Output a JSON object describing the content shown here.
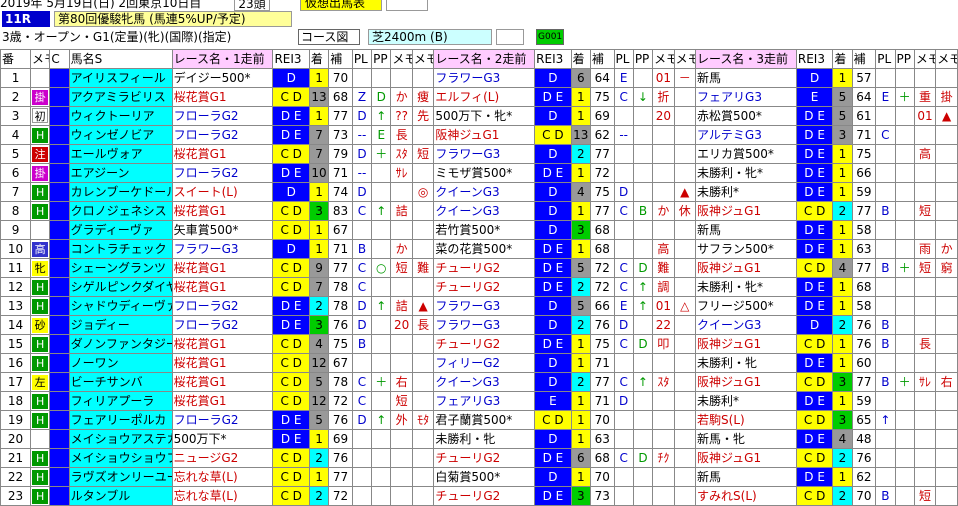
{
  "header": {
    "date": "2019年 5月19日(日) 2回東京10日目",
    "count": "23頭",
    "mode": "仮想出馬表",
    "race_no": "11R",
    "race_title": "第80回優駿牝馬 (馬連5%UP/予定)",
    "conditions": "3歳・オープン・G1(定量)(牝)(国際)(指定)",
    "course_label": "コース図",
    "course": "芝2400m (B)",
    "tag": "G001"
  },
  "columns": [
    "番",
    "メモ",
    "C",
    "馬名S",
    "レース名・1走前",
    "REI3",
    "着",
    "補",
    "PL",
    "PP",
    "メモ",
    "メモ",
    "レース名・2走前",
    "REI3",
    "着",
    "補",
    "PL",
    "PP",
    "メモ",
    "メモ",
    "レース名・3走前",
    "REI3",
    "着",
    "補",
    "PL",
    "PP",
    "メモ",
    "メモ"
  ],
  "rows": [
    {
      "no": "1",
      "memo": "",
      "c": "",
      "cc": "",
      "name": "アイリスフィール",
      "r1": "デイジー500*",
      "r1c": "black",
      "g1": "D",
      "g1b": "bgB",
      "p1": "1",
      "p1b": "bgY",
      "h1": "70",
      "pl1": "",
      "pp1": "",
      "m1a": "",
      "m1b": "",
      "r2": "フラワーG3",
      "r2c": "blue",
      "g2": "D",
      "g2b": "bgB",
      "p2": "6",
      "p2b": "bgGray",
      "h2": "64",
      "pl2": "E",
      "pp2": "",
      "m2a": "01",
      "m2b": "－",
      "r3": "新馬",
      "r3c": "black",
      "g3": "D",
      "g3b": "bgB",
      "p3": "1",
      "p3b": "bgY",
      "h3": "57",
      "pl3": "",
      "pp3": "",
      "m3a": "",
      "m3b": ""
    },
    {
      "no": "2",
      "memo": "掛",
      "mc": "t-purple",
      "c": "",
      "cc": "",
      "name": "アクアミラビリス",
      "r1": "桜花賞G1",
      "r1c": "",
      "g1": "C D",
      "g1b": "bgY",
      "p1": "13",
      "p1b": "bgGray",
      "h1": "68",
      "pl1": "Z",
      "pp1": "D",
      "m1a": "か",
      "m1b": "痩",
      "r2": "エルフィ(L)",
      "r2c": "",
      "g2": "D E",
      "g2b": "bgB",
      "p2": "1",
      "p2b": "bgY",
      "h2": "75",
      "pl2": "C",
      "pp2": "↓",
      "m2a": "折",
      "m2b": "",
      "r3": "フェアリG3",
      "r3c": "blue",
      "g3": "E",
      "g3b": "bgB",
      "p3": "5",
      "p3b": "bgGray",
      "h3": "64",
      "pl3": "E",
      "pp3": "＋",
      "m3a": "重",
      "m3b": "掛"
    },
    {
      "no": "3",
      "memo": "初",
      "mc": "t-white",
      "c": "",
      "cc": "",
      "name": "ウィクトーリア",
      "r1": "フローラG2",
      "r1c": "blue",
      "g1": "D E",
      "g1b": "bgB",
      "p1": "1",
      "p1b": "bgY",
      "h1": "77",
      "pl1": "D",
      "pp1": "↑",
      "m1a": "??",
      "m1b": "先",
      "r2": "500万下・牝*",
      "r2c": "black",
      "g2": "D",
      "g2b": "bgB",
      "p2": "1",
      "p2b": "bgY",
      "h2": "69",
      "pl2": "",
      "pp2": "",
      "m2a": "20",
      "m2b": "",
      "r3": "赤松賞500*",
      "r3c": "black",
      "g3": "D E",
      "g3b": "bgB",
      "p3": "5",
      "p3b": "bgGray",
      "h3": "61",
      "pl3": "",
      "pp3": "",
      "m3a": "01",
      "m3b": "▲"
    },
    {
      "no": "4",
      "memo": "H",
      "mc": "t-green",
      "c": "",
      "cc": "",
      "name": "ウィンゼノビア",
      "r1": "フローラG2",
      "r1c": "blue",
      "g1": "D E",
      "g1b": "bgB",
      "p1": "7",
      "p1b": "bgGray",
      "h1": "73",
      "pl1": "--",
      "pp1": "E",
      "m1a": "長",
      "m1b": "",
      "r2": "阪神ジュG1",
      "r2c": "",
      "g2": "C D",
      "g2b": "bgY",
      "p2": "13",
      "p2b": "bgGray",
      "h2": "62",
      "pl2": "--",
      "pp2": "",
      "m2a": "",
      "m2b": "",
      "r3": "アルテミG3",
      "r3c": "blue",
      "g3": "D E",
      "g3b": "bgB",
      "p3": "3",
      "p3b": "bgGray",
      "h3": "71",
      "pl3": "C",
      "pp3": "",
      "m3a": "",
      "m3b": ""
    },
    {
      "no": "5",
      "memo": "注",
      "mc": "t-red",
      "c": "",
      "cc": "",
      "name": "エールヴォア",
      "r1": "桜花賞G1",
      "r1c": "",
      "g1": "C D",
      "g1b": "bgY",
      "p1": "7",
      "p1b": "bgGray",
      "h1": "79",
      "pl1": "D",
      "pp1": "＋",
      "m1a": "ｽﾀ",
      "m1b": "短",
      "r2": "フラワーG3",
      "r2c": "blue",
      "g2": "D",
      "g2b": "bgB",
      "p2": "2",
      "p2b": "bgC",
      "h2": "77",
      "pl2": "",
      "pp2": "",
      "m2a": "",
      "m2b": "",
      "r3": "エリカ賞500*",
      "r3c": "black",
      "g3": "D E",
      "g3b": "bgB",
      "p3": "1",
      "p3b": "bgY",
      "h3": "75",
      "pl3": "",
      "pp3": "",
      "m3a": "高",
      "m3b": ""
    },
    {
      "no": "6",
      "memo": "掛",
      "mc": "t-purple",
      "c": "",
      "cc": "",
      "name": "エアジーン",
      "r1": "フローラG2",
      "r1c": "blue",
      "g1": "D E",
      "g1b": "bgB",
      "p1": "10",
      "p1b": "bgGray",
      "h1": "71",
      "pl1": "--",
      "pp1": "",
      "m1a": "ｻﾚ",
      "m1b": "",
      "r2": "ミモザ賞500*",
      "r2c": "black",
      "g2": "D E",
      "g2b": "bgB",
      "p2": "1",
      "p2b": "bgY",
      "h2": "72",
      "pl2": "",
      "pp2": "",
      "m2a": "",
      "m2b": "",
      "r3": "未勝利・牝*",
      "r3c": "black",
      "g3": "D E",
      "g3b": "bgB",
      "p3": "1",
      "p3b": "bgY",
      "h3": "66",
      "pl3": "",
      "pp3": "",
      "m3a": "",
      "m3b": ""
    },
    {
      "no": "7",
      "memo": "H",
      "mc": "t-green",
      "c": "",
      "cc": "",
      "name": "カレンブーケドール",
      "r1": "スイート(L)",
      "r1c": "",
      "g1": "D",
      "g1b": "bgB",
      "p1": "1",
      "p1b": "bgY",
      "h1": "74",
      "pl1": "D",
      "pp1": "",
      "m1a": "",
      "m1b": "◎",
      "r2": "クイーンG3",
      "r2c": "blue",
      "g2": "D",
      "g2b": "bgB",
      "p2": "4",
      "p2b": "bgGray",
      "h2": "75",
      "pl2": "D",
      "pp2": "",
      "m2a": "",
      "m2b": "▲",
      "r3": "未勝利*",
      "r3c": "black",
      "g3": "D E",
      "g3b": "bgB",
      "p3": "1",
      "p3b": "bgY",
      "h3": "59",
      "pl3": "",
      "pp3": "",
      "m3a": "",
      "m3b": ""
    },
    {
      "no": "8",
      "memo": "H",
      "mc": "t-green",
      "c": "",
      "cc": "",
      "name": "クロノジェネシス",
      "r1": "桜花賞G1",
      "r1c": "",
      "g1": "C D",
      "g1b": "bgY",
      "p1": "3",
      "p1b": "bgG",
      "h1": "83",
      "pl1": "C",
      "pp1": "↑",
      "m1a": "詰",
      "m1b": "",
      "r2": "クイーンG3",
      "r2c": "blue",
      "g2": "D",
      "g2b": "bgB",
      "p2": "1",
      "p2b": "bgY",
      "h2": "77",
      "pl2": "C",
      "pp2": "B",
      "m2a": "か",
      "m2b": "休",
      "r3": "阪神ジュG1",
      "r3c": "",
      "g3": "C D",
      "g3b": "bgY",
      "p3": "2",
      "p3b": "bgC",
      "h3": "77",
      "pl3": "B",
      "pp3": "",
      "m3a": "短",
      "m3b": ""
    },
    {
      "no": "9",
      "memo": "",
      "c": "",
      "cc": "",
      "name": "グラディーヴァ",
      "r1": "矢車賞500*",
      "r1c": "black",
      "g1": "C D",
      "g1b": "bgY",
      "p1": "1",
      "p1b": "bgY",
      "h1": "67",
      "pl1": "",
      "pp1": "",
      "m1a": "",
      "m1b": "",
      "r2": "若竹賞500*",
      "r2c": "black",
      "g2": "D",
      "g2b": "bgB",
      "p2": "3",
      "p2b": "bgG",
      "h2": "68",
      "pl2": "",
      "pp2": "",
      "m2a": "",
      "m2b": "",
      "r3": "新馬",
      "r3c": "black",
      "g3": "D E",
      "g3b": "bgB",
      "p3": "1",
      "p3b": "bgY",
      "h3": "58",
      "pl3": "",
      "pp3": "",
      "m3a": "",
      "m3b": ""
    },
    {
      "no": "10",
      "memo": "高",
      "mc": "t-blue",
      "c": "",
      "cc": "",
      "name": "コントラチェック",
      "r1": "フラワーG3",
      "r1c": "blue",
      "g1": "D",
      "g1b": "bgB",
      "p1": "1",
      "p1b": "bgY",
      "h1": "71",
      "pl1": "B",
      "pp1": "",
      "m1a": "か",
      "m1b": "",
      "r2": "菜の花賞500*",
      "r2c": "black",
      "g2": "D E",
      "g2b": "bgB",
      "p2": "1",
      "p2b": "bgY",
      "h2": "68",
      "pl2": "",
      "pp2": "",
      "m2a": "高",
      "m2b": "",
      "r3": "サフラン500*",
      "r3c": "black",
      "g3": "D E",
      "g3b": "bgB",
      "p3": "1",
      "p3b": "bgY",
      "h3": "63",
      "pl3": "",
      "pp3": "",
      "m3a": "雨",
      "m3b": "か"
    },
    {
      "no": "11",
      "memo": "牝",
      "mc": "t-yellow",
      "c": "",
      "cc": "",
      "name": "シェーングランツ",
      "r1": "桜花賞G1",
      "r1c": "",
      "g1": "C D",
      "g1b": "bgY",
      "p1": "9",
      "p1b": "bgGray",
      "h1": "77",
      "pl1": "C",
      "pp1": "○",
      "m1a": "短",
      "m1b": "難",
      "r2": "チューリG2",
      "r2c": "",
      "g2": "D E",
      "g2b": "bgB",
      "p2": "5",
      "p2b": "bgGray",
      "h2": "72",
      "pl2": "C",
      "pp2": "D",
      "m2a": "難",
      "m2b": "",
      "r3": "阪神ジュG1",
      "r3c": "",
      "g3": "C D",
      "g3b": "bgY",
      "p3": "4",
      "p3b": "bgGray",
      "h3": "77",
      "pl3": "B",
      "pp3": "＋",
      "m3a": "短",
      "m3b": "窮"
    },
    {
      "no": "12",
      "memo": "H",
      "mc": "t-green",
      "c": "",
      "cc": "",
      "name": "シゲルピンクダイヤ",
      "r1": "桜花賞G1",
      "r1c": "",
      "g1": "C D",
      "g1b": "bgY",
      "p1": "7",
      "p1b": "bgGray",
      "h1": "78",
      "pl1": "C",
      "pp1": "",
      "m1a": "",
      "m1b": "",
      "r2": "チューリG2",
      "r2c": "",
      "g2": "D E",
      "g2b": "bgB",
      "p2": "2",
      "p2b": "bgC",
      "h2": "72",
      "pl2": "C",
      "pp2": "↑",
      "m2a": "調",
      "m2b": "",
      "r3": "未勝利・牝*",
      "r3c": "black",
      "g3": "D E",
      "g3b": "bgB",
      "p3": "1",
      "p3b": "bgY",
      "h3": "68",
      "pl3": "",
      "pp3": "",
      "m3a": "",
      "m3b": ""
    },
    {
      "no": "13",
      "memo": "H",
      "mc": "t-green",
      "c": "",
      "cc": "",
      "name": "シャドウディーヴァ",
      "r1": "フローラG2",
      "r1c": "blue",
      "g1": "D E",
      "g1b": "bgB",
      "p1": "2",
      "p1b": "bgC",
      "h1": "78",
      "pl1": "D",
      "pp1": "↑",
      "m1a": "詰",
      "m1b": "▲",
      "r2": "フラワーG3",
      "r2c": "blue",
      "g2": "D",
      "g2b": "bgB",
      "p2": "5",
      "p2b": "bgGray",
      "h2": "66",
      "pl2": "E",
      "pp2": "↑",
      "m2a": "01",
      "m2b": "△",
      "r3": "フリージ500*",
      "r3c": "black",
      "g3": "D E",
      "g3b": "bgB",
      "p3": "1",
      "p3b": "bgY",
      "h3": "58",
      "pl3": "",
      "pp3": "",
      "m3a": "",
      "m3b": ""
    },
    {
      "no": "14",
      "memo": "砂",
      "mc": "t-yellow",
      "c": "",
      "cc": "",
      "name": "ジョディー",
      "r1": "フローラG2",
      "r1c": "blue",
      "g1": "D E",
      "g1b": "bgB",
      "p1": "3",
      "p1b": "bgG",
      "h1": "76",
      "pl1": "D",
      "pp1": "",
      "m1a": "20",
      "m1b": "長",
      "r2": "フラワーG3",
      "r2c": "blue",
      "g2": "D",
      "g2b": "bgB",
      "p2": "2",
      "p2b": "bgC",
      "h2": "76",
      "pl2": "D",
      "pp2": "",
      "m2a": "22",
      "m2b": "",
      "r3": "クイーンG3",
      "r3c": "blue",
      "g3": "D",
      "g3b": "bgB",
      "p3": "2",
      "p3b": "bgC",
      "h3": "76",
      "pl3": "B",
      "pp3": "",
      "m3a": "",
      "m3b": ""
    },
    {
      "no": "15",
      "memo": "H",
      "mc": "t-green",
      "c": "",
      "cc": "",
      "name": "ダノンファンタジー",
      "r1": "桜花賞G1",
      "r1c": "",
      "g1": "C D",
      "g1b": "bgY",
      "p1": "4",
      "p1b": "bgGray",
      "h1": "75",
      "pl1": "B",
      "pp1": "",
      "m1a": "",
      "m1b": "",
      "r2": "チューリG2",
      "r2c": "",
      "g2": "D E",
      "g2b": "bgB",
      "p2": "1",
      "p2b": "bgY",
      "h2": "75",
      "pl2": "C",
      "pp2": "D",
      "m2a": "叩",
      "m2b": "",
      "r3": "阪神ジュG1",
      "r3c": "",
      "g3": "C D",
      "g3b": "bgY",
      "p3": "1",
      "p3b": "bgY",
      "h3": "76",
      "pl3": "B",
      "pp3": "",
      "m3a": "長",
      "m3b": ""
    },
    {
      "no": "16",
      "memo": "H",
      "mc": "t-green",
      "c": "",
      "cc": "",
      "name": "ノーワン",
      "r1": "桜花賞G1",
      "r1c": "",
      "g1": "C D",
      "g1b": "bgY",
      "p1": "12",
      "p1b": "bgGray",
      "h1": "67",
      "pl1": "",
      "pp1": "",
      "m1a": "",
      "m1b": "",
      "r2": "フィリーG2",
      "r2c": "blue",
      "g2": "D",
      "g2b": "bgB",
      "p2": "1",
      "p2b": "bgY",
      "h2": "71",
      "pl2": "",
      "pp2": "",
      "m2a": "",
      "m2b": "",
      "r3": "未勝利・牝",
      "r3c": "black",
      "g3": "D E",
      "g3b": "bgB",
      "p3": "1",
      "p3b": "bgY",
      "h3": "60",
      "pl3": "",
      "pp3": "",
      "m3a": "",
      "m3b": ""
    },
    {
      "no": "17",
      "memo": "左",
      "mc": "t-yellow",
      "c": "",
      "cc": "",
      "name": "ビーチサンバ",
      "r1": "桜花賞G1",
      "r1c": "",
      "g1": "C D",
      "g1b": "bgY",
      "p1": "5",
      "p1b": "bgGray",
      "h1": "78",
      "pl1": "C",
      "pp1": "＋",
      "m1a": "右",
      "m1b": "",
      "r2": "クイーンG3",
      "r2c": "blue",
      "g2": "D",
      "g2b": "bgB",
      "p2": "2",
      "p2b": "bgC",
      "h2": "77",
      "pl2": "C",
      "pp2": "↑",
      "m2a": "ｽﾀ",
      "m2b": "",
      "r3": "阪神ジュG1",
      "r3c": "",
      "g3": "C D",
      "g3b": "bgY",
      "p3": "3",
      "p3b": "bgG",
      "h3": "77",
      "pl3": "B",
      "pp3": "＋",
      "m3a": "ｻﾚ",
      "m3b": "右"
    },
    {
      "no": "18",
      "memo": "H",
      "mc": "t-green",
      "c": "",
      "cc": "",
      "name": "フィリアプーラ",
      "r1": "桜花賞G1",
      "r1c": "",
      "g1": "C D",
      "g1b": "bgY",
      "p1": "12",
      "p1b": "bgGray",
      "h1": "72",
      "pl1": "C",
      "pp1": "",
      "m1a": "短",
      "m1b": "",
      "r2": "フェアリG3",
      "r2c": "blue",
      "g2": "E",
      "g2b": "bgB",
      "p2": "1",
      "p2b": "bgY",
      "h2": "71",
      "pl2": "D",
      "pp2": "",
      "m2a": "",
      "m2b": "",
      "r3": "未勝利*",
      "r3c": "black",
      "g3": "D E",
      "g3b": "bgB",
      "p3": "1",
      "p3b": "bgY",
      "h3": "59",
      "pl3": "",
      "pp3": "",
      "m3a": "",
      "m3b": ""
    },
    {
      "no": "19",
      "memo": "H",
      "mc": "t-green",
      "c": "",
      "cc": "",
      "name": "フェアリーポルカ",
      "r1": "フローラG2",
      "r1c": "blue",
      "g1": "D E",
      "g1b": "bgB",
      "p1": "5",
      "p1b": "bgGray",
      "h1": "76",
      "pl1": "D",
      "pp1": "↑",
      "m1a": "外",
      "m1b": "ﾓﾀ",
      "r2": "君子蘭賞500*",
      "r2c": "black",
      "g2": "C D",
      "g2b": "bgY",
      "p2": "1",
      "p2b": "bgY",
      "h2": "70",
      "pl2": "",
      "pp2": "",
      "m2a": "",
      "m2b": "",
      "r3": "若駒S(L)",
      "r3c": "",
      "g3": "C D",
      "g3b": "bgY",
      "p3": "3",
      "p3b": "bgG",
      "h3": "65",
      "pl3": "↑",
      "pp3": "",
      "m3a": "",
      "m3b": ""
    },
    {
      "no": "20",
      "memo": "",
      "c": "",
      "cc": "",
      "name": "メイショウアステカ",
      "r1": "500万下*",
      "r1c": "black",
      "g1": "D E",
      "g1b": "bgB",
      "p1": "1",
      "p1b": "bgY",
      "h1": "69",
      "pl1": "",
      "pp1": "",
      "m1a": "",
      "m1b": "",
      "r2": "未勝利・牝",
      "r2c": "black",
      "g2": "D",
      "g2b": "bgB",
      "p2": "1",
      "p2b": "bgY",
      "h2": "63",
      "pl2": "",
      "pp2": "",
      "m2a": "",
      "m2b": "",
      "r3": "新馬・牝",
      "r3c": "black",
      "g3": "D E",
      "g3b": "bgB",
      "p3": "4",
      "p3b": "bgGray",
      "h3": "48",
      "pl3": "",
      "pp3": "",
      "m3a": "",
      "m3b": ""
    },
    {
      "no": "21",
      "memo": "H",
      "mc": "t-green",
      "c": "",
      "cc": "",
      "name": "メイショウショウブ",
      "r1": "ニュージG2",
      "r1c": "",
      "g1": "C D",
      "g1b": "bgY",
      "p1": "2",
      "p1b": "bgC",
      "h1": "76",
      "pl1": "",
      "pp1": "",
      "m1a": "",
      "m1b": "",
      "r2": "チューリG2",
      "r2c": "",
      "g2": "D E",
      "g2b": "bgB",
      "p2": "6",
      "p2b": "bgGray",
      "h2": "68",
      "pl2": "C",
      "pp2": "D",
      "m2a": "ﾁｸ",
      "m2b": "",
      "r3": "阪神ジュG1",
      "r3c": "",
      "g3": "C D",
      "g3b": "bgY",
      "p3": "2",
      "p3b": "bgC",
      "h3": "76",
      "pl3": "",
      "pp3": "",
      "m3a": "",
      "m3b": ""
    },
    {
      "no": "22",
      "memo": "H",
      "mc": "t-green",
      "c": "",
      "cc": "",
      "name": "ラヴズオンリーユー",
      "r1": "忘れな草(L)",
      "r1c": "",
      "g1": "C D",
      "g1b": "bgY",
      "p1": "1",
      "p1b": "bgY",
      "h1": "77",
      "pl1": "",
      "pp1": "",
      "m1a": "",
      "m1b": "",
      "r2": "白菊賞500*",
      "r2c": "black",
      "g2": "D",
      "g2b": "bgB",
      "p2": "1",
      "p2b": "bgY",
      "h2": "70",
      "pl2": "",
      "pp2": "",
      "m2a": "",
      "m2b": "",
      "r3": "新馬",
      "r3c": "black",
      "g3": "D E",
      "g3b": "bgB",
      "p3": "1",
      "p3b": "bgY",
      "h3": "62",
      "pl3": "",
      "pp3": "",
      "m3a": "",
      "m3b": ""
    },
    {
      "no": "23",
      "memo": "H",
      "mc": "t-green",
      "c": "",
      "cc": "",
      "name": "ルタンブル",
      "r1": "忘れな草(L)",
      "r1c": "",
      "g1": "C D",
      "g1b": "bgY",
      "p1": "2",
      "p1b": "bgC",
      "h1": "72",
      "pl1": "",
      "pp1": "",
      "m1a": "",
      "m1b": "",
      "r2": "チューリG2",
      "r2c": "",
      "g2": "D E",
      "g2b": "bgB",
      "p2": "3",
      "p2b": "bgG",
      "h2": "73",
      "pl2": "",
      "pp2": "",
      "m2a": "",
      "m2b": "",
      "r3": "すみれS(L)",
      "r3c": "",
      "g3": "C D",
      "g3b": "bgY",
      "p3": "2",
      "p3b": "bgC",
      "h3": "70",
      "pl3": "B",
      "pp3": "",
      "m3a": "短",
      "m3b": ""
    }
  ]
}
